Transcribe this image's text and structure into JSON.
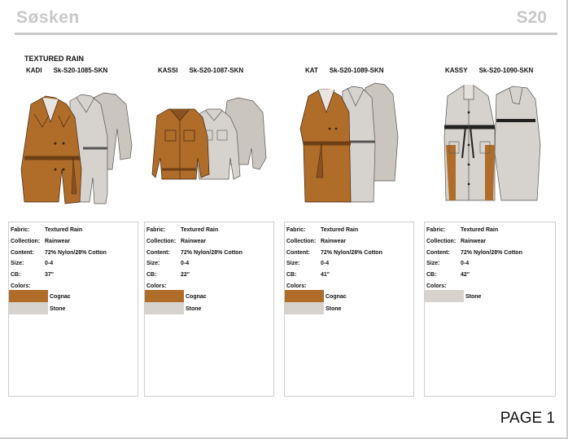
{
  "header": {
    "brand": "Søsken",
    "season": "S20"
  },
  "group_title": "TEXTURED RAIN",
  "colors": {
    "cognac": "#b06d2a",
    "stone": "#d6d2cd"
  },
  "styles": [
    {
      "name": "KADI",
      "code": "Sk-S20-1085-SKN",
      "fabric_label": "Fabric:",
      "fabric": "Textured Rain",
      "collection_label": "Collection:",
      "collection": "Rainwear",
      "content_label": "Content:",
      "content": "72% Nylon/28% Cotton",
      "size_label": "Size:",
      "size": "0-4",
      "cb_label": "CB:",
      "cb": "37\"",
      "colors_label": "Colors:",
      "colors": [
        {
          "name": "Cognac",
          "hex": "#b06d2a"
        },
        {
          "name": "Stone",
          "hex": "#d6d2cd"
        }
      ]
    },
    {
      "name": "KASSI",
      "code": "Sk-S20-1087-SKN",
      "fabric_label": "Fabric:",
      "fabric": "Textured Rain",
      "collection_label": "Collection:",
      "collection": "Rainwear",
      "content_label": "Content:",
      "content": "72% Nylon/28% Cotton",
      "size_label": "Size:",
      "size": "0-4",
      "cb_label": "CB:",
      "cb": "22\"",
      "colors_label": "Colors:",
      "colors": [
        {
          "name": "Cognac",
          "hex": "#b06d2a"
        },
        {
          "name": "Stone",
          "hex": "#d6d2cd"
        }
      ]
    },
    {
      "name": "KAT",
      "code": "Sk-S20-1089-SKN",
      "fabric_label": "Fabric:",
      "fabric": "Textured Rain",
      "collection_label": "Collection:",
      "collection": "Rainwear",
      "content_label": "Content:",
      "content": "72% Nylon/28% Cotton",
      "size_label": "Size:",
      "size": "0-4",
      "cb_label": "CB:",
      "cb": "41\"",
      "colors_label": "Colors:",
      "colors": [
        {
          "name": "Cognac",
          "hex": "#b06d2a"
        },
        {
          "name": "Stone",
          "hex": "#d6d2cd"
        }
      ]
    },
    {
      "name": "KASSY",
      "code": "Sk-S20-1090-SKN",
      "fabric_label": "Fabric:",
      "fabric": "Textured Rain",
      "collection_label": "Collection:",
      "collection": "Rainwear",
      "content_label": "Content:",
      "content": "72% Nylon/28% Cotton",
      "size_label": "Size:",
      "size": "0-4",
      "cb_label": "CB:",
      "cb": "42\"",
      "colors_label": "Colors:",
      "colors": [
        {
          "name": "Stone",
          "hex": "#d6d2cd"
        }
      ]
    }
  ],
  "footer": {
    "page_label": "PAGE 1"
  }
}
